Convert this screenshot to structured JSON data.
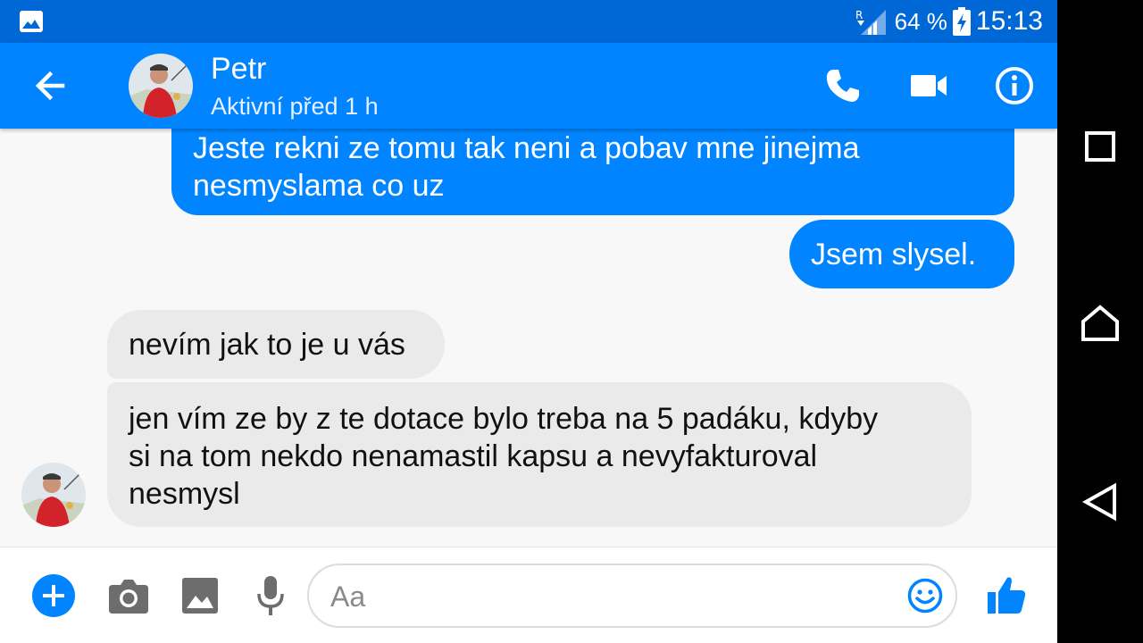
{
  "status_bar": {
    "notification_icon": "image-icon",
    "signal_icon": "signal-roaming-icon",
    "roaming_label": "R",
    "battery_percent": "64 %",
    "battery_icon": "battery-charging-icon",
    "time": "15:13"
  },
  "header": {
    "back_icon": "arrow-back-icon",
    "contact_name": "Petr",
    "contact_status": "Aktivní před 1 h",
    "actions": [
      "phone-icon",
      "video-call-icon",
      "info-icon"
    ]
  },
  "messages": [
    {
      "direction": "outgoing",
      "text": "Jeste rekni ze tomu tak neni a pobav mne jinejma\nnesmyslama co uz"
    },
    {
      "direction": "outgoing",
      "text": "Jsem slysel."
    },
    {
      "direction": "incoming",
      "text": "nevím jak to je u vás"
    },
    {
      "direction": "incoming",
      "text": "jen vím ze by z te dotace bylo treba na 5 padáku, kdyby\nsi na tom nekdo nenamastil kapsu a nevyfakturoval\nnesmysl"
    }
  ],
  "composer": {
    "placeholder": "Aa",
    "icons": [
      "plus-icon",
      "camera-icon",
      "gallery-icon",
      "microphone-icon",
      "emoji-icon",
      "thumbs-up-icon"
    ]
  },
  "navigation_bar": [
    "recents-icon",
    "home-icon",
    "back-triangle-icon"
  ],
  "colors": {
    "status_bar": "#0068d6",
    "header": "#0084ff",
    "outgoing_bubble": "#0084ff",
    "incoming_bubble": "#eaeaea"
  }
}
